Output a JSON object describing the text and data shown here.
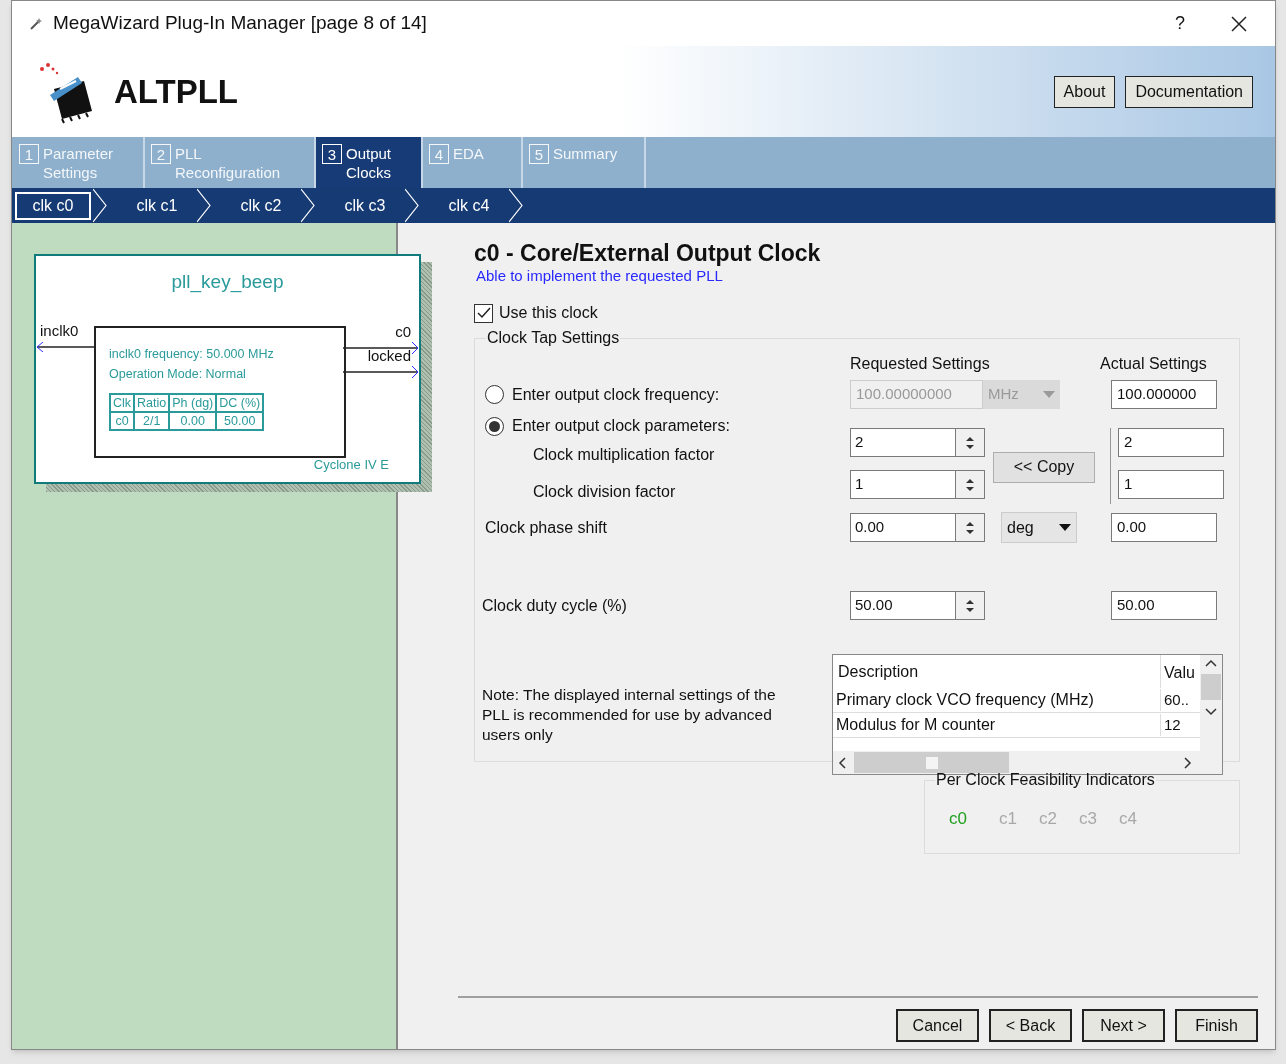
{
  "window": {
    "title": "MegaWizard Plug-In Manager [page 8 of 14]",
    "help": "?"
  },
  "header": {
    "product": "ALTPLL",
    "buttons": [
      "About",
      "Documentation"
    ]
  },
  "tabs": [
    {
      "number": "1",
      "label": "Parameter Settings",
      "selected": false
    },
    {
      "number": "2",
      "label": "PLL Reconfiguration",
      "selected": false
    },
    {
      "number": "3",
      "label": "Output Clocks",
      "selected": true
    },
    {
      "number": "4",
      "label": "EDA",
      "selected": false
    },
    {
      "number": "5",
      "label": "Summary",
      "selected": false
    }
  ],
  "clock_tabs": [
    {
      "label": "clk c0",
      "selected": true
    },
    {
      "label": "clk c1",
      "selected": false
    },
    {
      "label": "clk c2",
      "selected": false
    },
    {
      "label": "clk c3",
      "selected": false
    },
    {
      "label": "clk c4",
      "selected": false
    }
  ],
  "diagram": {
    "name": "pll_key_beep",
    "input": "inclk0",
    "outputs": [
      "c0",
      "locked"
    ],
    "info": [
      "inclk0 frequency: 50.000 MHz",
      "Operation Mode: Normal"
    ],
    "table": {
      "columns": [
        "Clk",
        "Ratio",
        "Ph (dg)",
        "DC (%)"
      ],
      "rows": [
        [
          "c0",
          "2/1",
          "0.00",
          "50.00"
        ]
      ]
    },
    "device": "Cyclone IV E"
  },
  "output_clock": {
    "title": "c0 - Core/External Output Clock",
    "status": "Able to implement the requested PLL",
    "use_clock": {
      "label": "Use this clock",
      "checked": true
    },
    "clock_tap": {
      "title": "Clock Tap Settings",
      "requested_heading": "Requested Settings",
      "actual_heading": "Actual Settings",
      "frequency": {
        "label": "Enter output clock frequency:",
        "selected": false,
        "disabled": true,
        "value": "100.00000000",
        "unit": "MHz",
        "actual": "100.000000"
      },
      "parameters": {
        "label": "Enter output clock parameters:",
        "selected": true
      },
      "multiplication": {
        "label": "Clock multiplication factor",
        "value": "2",
        "actual": "2"
      },
      "division": {
        "label": "Clock division factor",
        "value": "1",
        "actual": "1"
      },
      "copy_button": "<< Copy",
      "phase_shift": {
        "label": "Clock phase shift",
        "value": "0.00",
        "unit": "deg",
        "actual": "0.00"
      },
      "duty_cycle": {
        "label": "Clock duty cycle (%)",
        "value": "50.00",
        "actual": "50.00"
      },
      "note": "Note: The displayed internal settings of the PLL is recommended for use by advanced users only",
      "internal_settings": {
        "columns": [
          "Description",
          "Valu"
        ],
        "rows": [
          [
            "Primary clock VCO frequency (MHz)",
            "60.."
          ],
          [
            "Modulus for M counter",
            "12"
          ]
        ]
      }
    },
    "feasibility": {
      "title": "Per Clock Feasibility Indicators",
      "clocks": [
        {
          "label": "c0",
          "feasible": true
        },
        {
          "label": "c1",
          "feasible": false
        },
        {
          "label": "c2",
          "feasible": false
        },
        {
          "label": "c3",
          "feasible": false
        },
        {
          "label": "c4",
          "feasible": false
        }
      ]
    }
  },
  "buttons": [
    "Cancel",
    "< Back",
    "Next >",
    "Finish"
  ]
}
